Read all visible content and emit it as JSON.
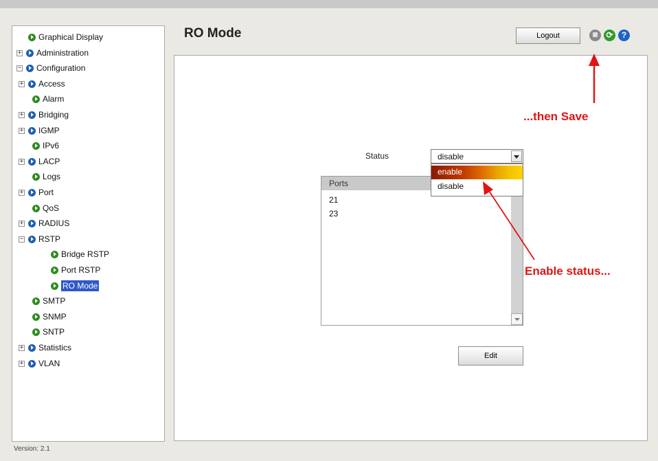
{
  "header": {
    "page_title": "RO Mode",
    "logout_label": "Logout",
    "refresh_glyph": "⟳",
    "help_glyph": "?"
  },
  "sidebar": {
    "items": [
      {
        "label": "Graphical Display",
        "level": 0,
        "expander": "",
        "bullet": "green",
        "selected": false
      },
      {
        "label": "Administration",
        "level": 0,
        "expander": "+",
        "bullet": "blue",
        "selected": false
      },
      {
        "label": "Configuration",
        "level": 0,
        "expander": "−",
        "bullet": "blue",
        "selected": false
      },
      {
        "label": "Access",
        "level": 1,
        "expander": "+",
        "bullet": "blue",
        "selected": false
      },
      {
        "label": "Alarm",
        "level": 1,
        "expander": "",
        "bullet": "green",
        "selected": false
      },
      {
        "label": "Bridging",
        "level": 1,
        "expander": "+",
        "bullet": "blue",
        "selected": false
      },
      {
        "label": "IGMP",
        "level": 1,
        "expander": "+",
        "bullet": "blue",
        "selected": false
      },
      {
        "label": "IPv6",
        "level": 1,
        "expander": "",
        "bullet": "green",
        "selected": false
      },
      {
        "label": "LACP",
        "level": 1,
        "expander": "+",
        "bullet": "blue",
        "selected": false
      },
      {
        "label": "Logs",
        "level": 1,
        "expander": "",
        "bullet": "green",
        "selected": false
      },
      {
        "label": "Port",
        "level": 1,
        "expander": "+",
        "bullet": "blue",
        "selected": false
      },
      {
        "label": "QoS",
        "level": 1,
        "expander": "",
        "bullet": "green",
        "selected": false
      },
      {
        "label": "RADIUS",
        "level": 1,
        "expander": "+",
        "bullet": "blue",
        "selected": false
      },
      {
        "label": "RSTP",
        "level": 1,
        "expander": "−",
        "bullet": "blue",
        "selected": false
      },
      {
        "label": "Bridge RSTP",
        "level": 2,
        "expander": "",
        "bullet": "green",
        "selected": false
      },
      {
        "label": "Port RSTP",
        "level": 2,
        "expander": "",
        "bullet": "green",
        "selected": false
      },
      {
        "label": "RO Mode",
        "level": 2,
        "expander": "",
        "bullet": "green",
        "selected": true
      },
      {
        "label": "SMTP",
        "level": 1,
        "expander": "",
        "bullet": "green",
        "selected": false
      },
      {
        "label": "SNMP",
        "level": 1,
        "expander": "",
        "bullet": "green",
        "selected": false
      },
      {
        "label": "SNTP",
        "level": 1,
        "expander": "",
        "bullet": "green",
        "selected": false
      },
      {
        "label": "Statistics",
        "level": 1,
        "expander": "+",
        "bullet": "blue",
        "selected": false
      },
      {
        "label": "VLAN",
        "level": 1,
        "expander": "+",
        "bullet": "blue",
        "selected": false
      }
    ]
  },
  "main": {
    "status_label": "Status",
    "status_value": "disable",
    "dropdown_options": [
      "enable",
      "disable"
    ],
    "highlighted_option": "enable",
    "ports_header": "Ports",
    "ports": [
      "21",
      "23"
    ],
    "edit_label": "Edit"
  },
  "footer": {
    "version": "Version: 2.1"
  },
  "annotations": {
    "save_hint": "...then Save",
    "enable_hint": "Enable status..."
  },
  "colors": {
    "annotation": "#e01414",
    "selected_item": "#2e59c9",
    "green_bullet": "#2e8b1f",
    "blue_bullet": "#1e5fb4"
  }
}
